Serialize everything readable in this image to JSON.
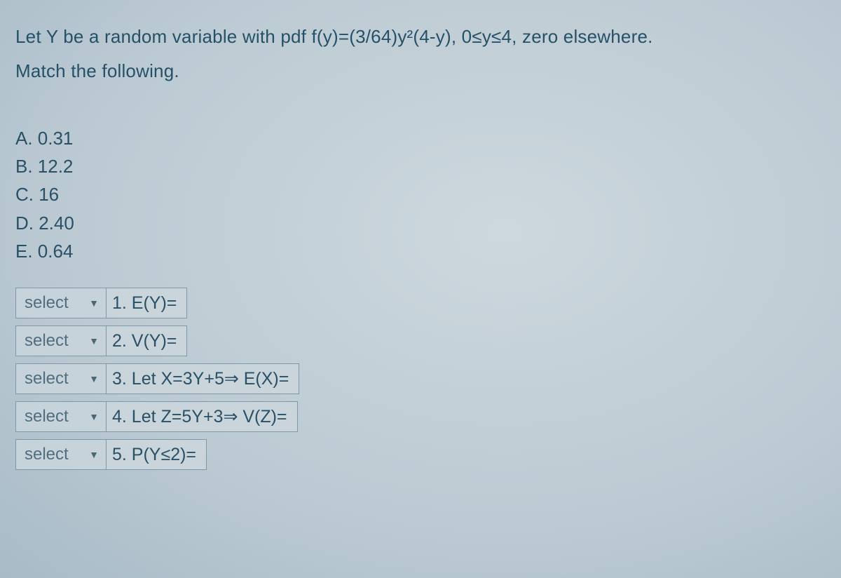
{
  "prompt": {
    "line1": "Let Y be a random variable with pdf  f(y)=(3/64)y²(4-y), 0≤y≤4, zero elsewhere.",
    "line2": "Match the following."
  },
  "options": [
    "A. 0.31",
    "B. 12.2",
    "C. 16",
    "D. 2.40",
    "E. 0.64"
  ],
  "select_placeholder": "select",
  "matches": [
    {
      "label": "1. E(Y)="
    },
    {
      "label": "2. V(Y)="
    },
    {
      "label": "3. Let X=3Y+5⇒ E(X)="
    },
    {
      "label": "4. Let Z=5Y+3⇒ V(Z)="
    },
    {
      "label": "5. P(Y≤2)="
    }
  ]
}
